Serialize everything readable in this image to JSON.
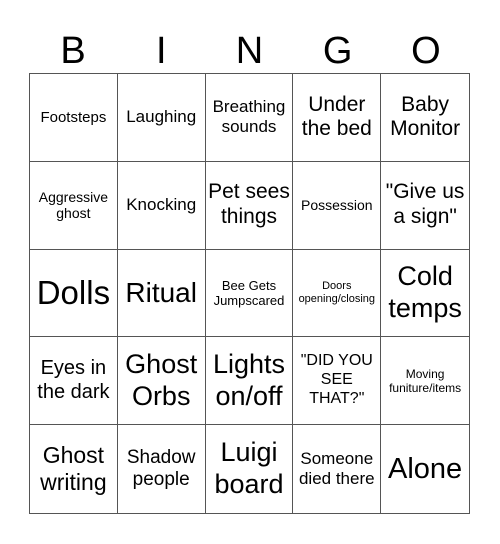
{
  "header": [
    "B",
    "I",
    "N",
    "G",
    "O"
  ],
  "cells": [
    {
      "text": "Footsteps",
      "size": 15
    },
    {
      "text": "Laughing",
      "size": 17
    },
    {
      "text": "Breathing sounds",
      "size": 17
    },
    {
      "text": "Under the bed",
      "size": 21
    },
    {
      "text": "Baby Monitor",
      "size": 21
    },
    {
      "text": "Aggressive ghost",
      "size": 14
    },
    {
      "text": "Knocking",
      "size": 17
    },
    {
      "text": "Pet sees things",
      "size": 21
    },
    {
      "text": "Possession",
      "size": 14
    },
    {
      "text": "\"Give us a sign\"",
      "size": 21
    },
    {
      "text": "Dolls",
      "size": 33
    },
    {
      "text": "Ritual",
      "size": 28
    },
    {
      "text": "Bee Gets Jumpscared",
      "size": 13
    },
    {
      "text": "Doors opening/closing",
      "size": 11
    },
    {
      "text": "Cold temps",
      "size": 27
    },
    {
      "text": "Eyes in the dark",
      "size": 20
    },
    {
      "text": "Ghost Orbs",
      "size": 27
    },
    {
      "text": "Lights on/off",
      "size": 27
    },
    {
      "text": "\"DID YOU SEE THAT?\"",
      "size": 16
    },
    {
      "text": "Moving funiture/items",
      "size": 12
    },
    {
      "text": "Ghost writing",
      "size": 23
    },
    {
      "text": "Shadow people",
      "size": 19
    },
    {
      "text": "Luigi board",
      "size": 27
    },
    {
      "text": "Someone died there",
      "size": 17
    },
    {
      "text": "Alone",
      "size": 29
    }
  ]
}
